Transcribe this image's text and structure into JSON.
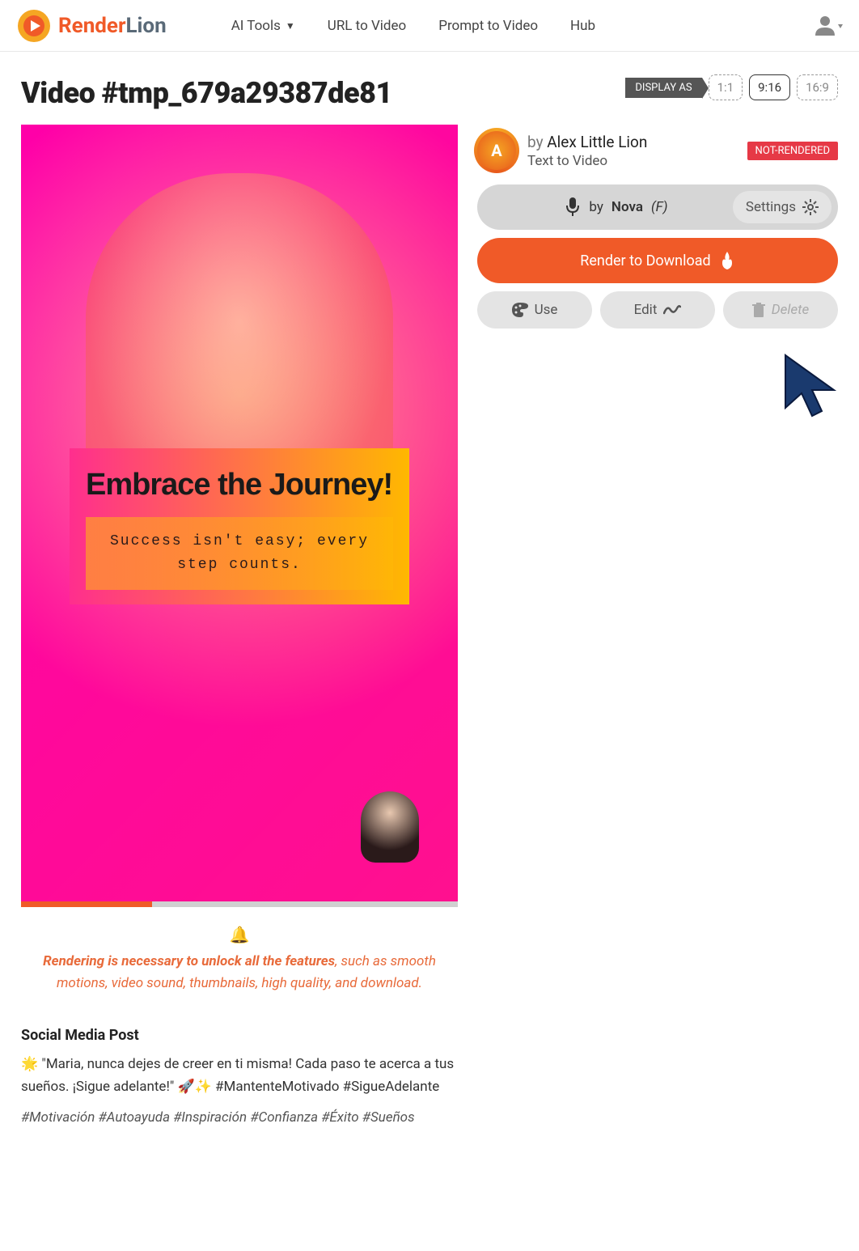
{
  "header": {
    "brand1": "Render",
    "brand2": "Lion",
    "nav": {
      "ai_tools": "AI Tools",
      "url_to_video": "URL to Video",
      "prompt_to_video": "Prompt to Video",
      "hub": "Hub"
    }
  },
  "page": {
    "title": "Video #tmp_679a29387de81",
    "display_as": "DISPLAY AS",
    "ratios": {
      "r1": "1:1",
      "r2": "9:16",
      "r3": "16:9"
    }
  },
  "preview": {
    "headline": "Embrace the Journey!",
    "subline": "Success isn't easy; every step counts."
  },
  "notice": {
    "strong": "Rendering is necessary to unlock all the features",
    "rest": ", such as smooth motions, video sound, thumbnails, high quality, and download."
  },
  "social": {
    "heading": "Social Media Post",
    "body": "🌟 \"Maria, nunca dejes de creer en ti misma! Cada paso te acerca a tus sueños. ¡Sigue adelante!\" 🚀✨ #MantenteMotivado #SigueAdelante",
    "tags": "#Motivación #Autoayuda #Inspiración #Confianza #Éxito #Sueños"
  },
  "side": {
    "by": "by ",
    "author": "Alex Little Lion",
    "subtitle": "Text to Video",
    "avatar_letter": "A",
    "status": "NOT-RENDERED",
    "voice_by": "by ",
    "voice_name": "Nova",
    "voice_gender": "(F)",
    "settings": "Settings",
    "render": "Render to Download",
    "use": "Use",
    "edit": "Edit",
    "delete": "Delete"
  }
}
